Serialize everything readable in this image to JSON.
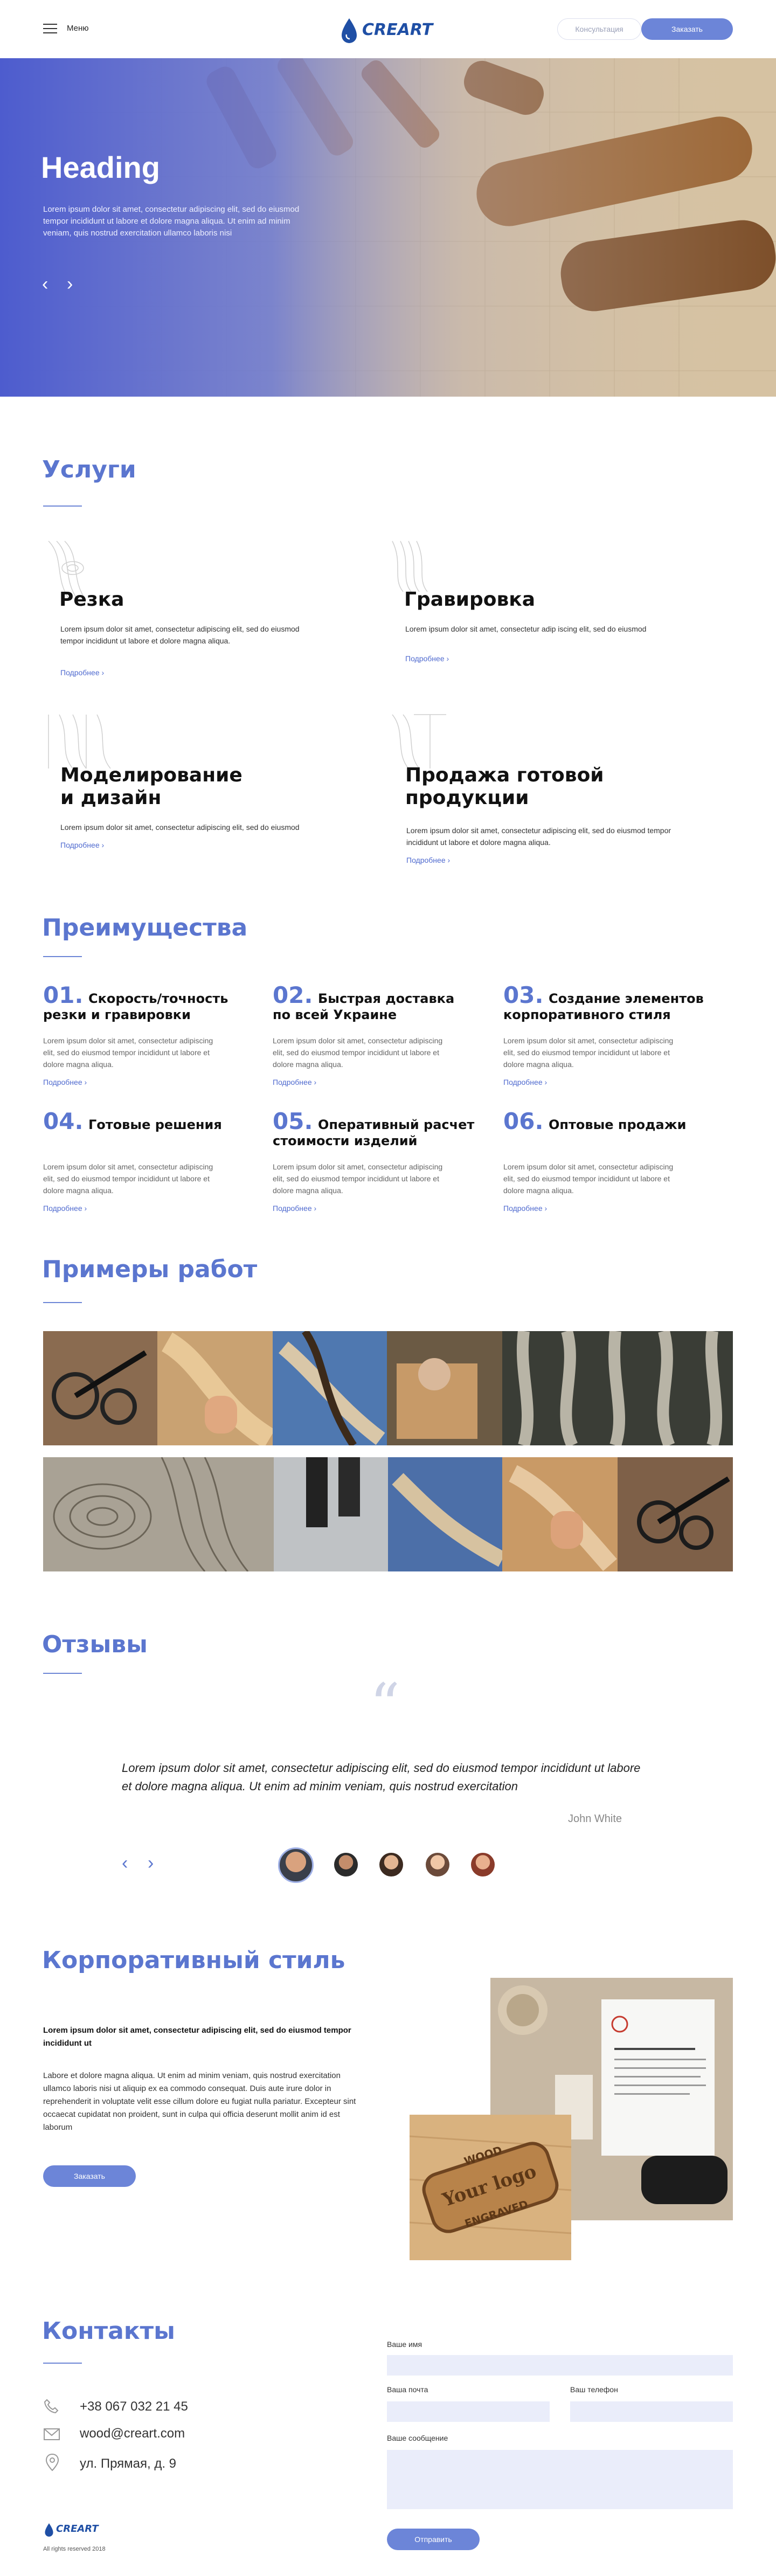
{
  "header": {
    "menu_label": "Меню",
    "logo_text": "CREART",
    "consult_label": "Консультация",
    "order_label": "Заказать"
  },
  "hero": {
    "title": "Heading",
    "text": "Lorem ipsum dolor sit amet, consectetur adipiscing elit, sed do eiusmod tempor incididunt ut labore et dolore magna aliqua. Ut enim ad minim veniam, quis nostrud exercitation ullamco laboris nisi",
    "prev": "‹",
    "next": "›"
  },
  "services": {
    "title": "Услуги",
    "items": [
      {
        "title": "Резка",
        "text": "Lorem ipsum dolor sit amet, consectetur adipiscing elit, sed do eiusmod tempor incididunt ut labore et dolore magna aliqua.",
        "more": "Подробнее ›"
      },
      {
        "title": "Гравировка",
        "text": "Lorem ipsum dolor sit amet, consectetur adip    iscing elit, sed do eiusmod",
        "more": "Подробнее ›"
      },
      {
        "title_line1": "Моделирование",
        "title_line2": "и дизайн",
        "text": "Lorem ipsum dolor sit amet, consectetur adipiscing elit, sed do eiusmod",
        "more": "Подробнее ›"
      },
      {
        "title_line1": "Продажа готовой",
        "title_line2": "продукции",
        "text": "Lorem ipsum dolor sit amet, consectetur adipiscing elit, sed do eiusmod tempor incididunt ut labore et dolore magna aliqua.",
        "more": "Подробнее ›"
      }
    ]
  },
  "advantages": {
    "title": "Преимущества",
    "items": [
      {
        "num": "01.",
        "title_line1": "Скорость/точность",
        "title_line2": "резки и гравировки",
        "text": "Lorem ipsum dolor sit amet, consectetur adipiscing elit, sed do eiusmod tempor incididunt ut labore et dolore magna aliqua.",
        "more": "Подробнее ›"
      },
      {
        "num": "02.",
        "title_line1": "Быстрая доставка",
        "title_line2": "по всей Украине",
        "text": "Lorem ipsum dolor sit amet, consectetur adipiscing elit, sed do eiusmod tempor incididunt ut labore et dolore magna aliqua.",
        "more": "Подробнее ›"
      },
      {
        "num": "03.",
        "title_line1": "Создание элементов",
        "title_line2": "корпоративного стиля",
        "text": "Lorem ipsum dolor sit amet, consectetur adipiscing elit, sed do eiusmod tempor incididunt ut labore et dolore magna aliqua.",
        "more": "Подробнее ›"
      },
      {
        "num": "04.",
        "title_line1": "Готовые решения",
        "title_line2": "",
        "text": "Lorem ipsum dolor sit amet, consectetur adipiscing elit, sed do eiusmod tempor incididunt ut labore et dolore magna aliqua.",
        "more": "Подробнее ›"
      },
      {
        "num": "05.",
        "title_line1": "Оперативный расчет",
        "title_line2": "стоимости изделий",
        "text": "Lorem ipsum dolor sit amet, consectetur adipiscing elit, sed do eiusmod tempor incididunt ut labore et dolore magna aliqua.",
        "more": "Подробнее ›"
      },
      {
        "num": "06.",
        "title_line1": "Оптовые продажи",
        "title_line2": "",
        "text": "Lorem ipsum dolor sit amet, consectetur adipiscing elit, sed do eiusmod tempor incididunt ut labore et dolore magna aliqua.",
        "more": "Подробнее ›"
      }
    ]
  },
  "portfolio": {
    "title": "Примеры работ"
  },
  "reviews": {
    "title": "Отзывы",
    "quote_mark": "“",
    "text": "Lorem ipsum dolor sit amet, consectetur adipiscing elit, sed do eiusmod tempor incididunt ut labore et dolore magna aliqua. Ut enim ad minim veniam, quis nostrud exercitation",
    "author": "John White",
    "prev": "‹",
    "next": "›"
  },
  "corporate": {
    "title": "Корпоративный стиль",
    "bold_text": "Lorem ipsum dolor sit amet, consectetur adipiscing elit, sed do eiusmod tempor incididunt ut",
    "text": "Labore et dolore magna aliqua. Ut enim ad minim veniam, quis nostrud exercitation ullamco laboris nisi ut aliquip ex ea commodo consequat. Duis aute irure dolor in reprehenderit in voluptate velit esse cillum dolore eu fugiat nulla pariatur. Excepteur sint occaecat cupidatat non proident, sunt in culpa qui officia deserunt mollit anim id est laborum",
    "order_label": "Заказать",
    "stamp_line1": "WOOD",
    "stamp_line2": "Your logo",
    "stamp_line3": "ENGRAVED"
  },
  "contacts": {
    "title": "Контакты",
    "phone": "+38 067 032 21 45",
    "email": "wood@creart.com",
    "address": "ул. Прямая, д. 9",
    "form": {
      "name_label": "Ваше имя",
      "email_label": "Ваша почта",
      "phone_label": "Ваш телефон",
      "message_label": "Ваше сообщение",
      "submit_label": "Отправить"
    }
  },
  "footer": {
    "logo_text": "CREART",
    "rights": "All rights reserved 2018"
  },
  "colors": {
    "accent": "#5b76cf",
    "button": "#6c85d8",
    "field": "#eaedfa"
  }
}
